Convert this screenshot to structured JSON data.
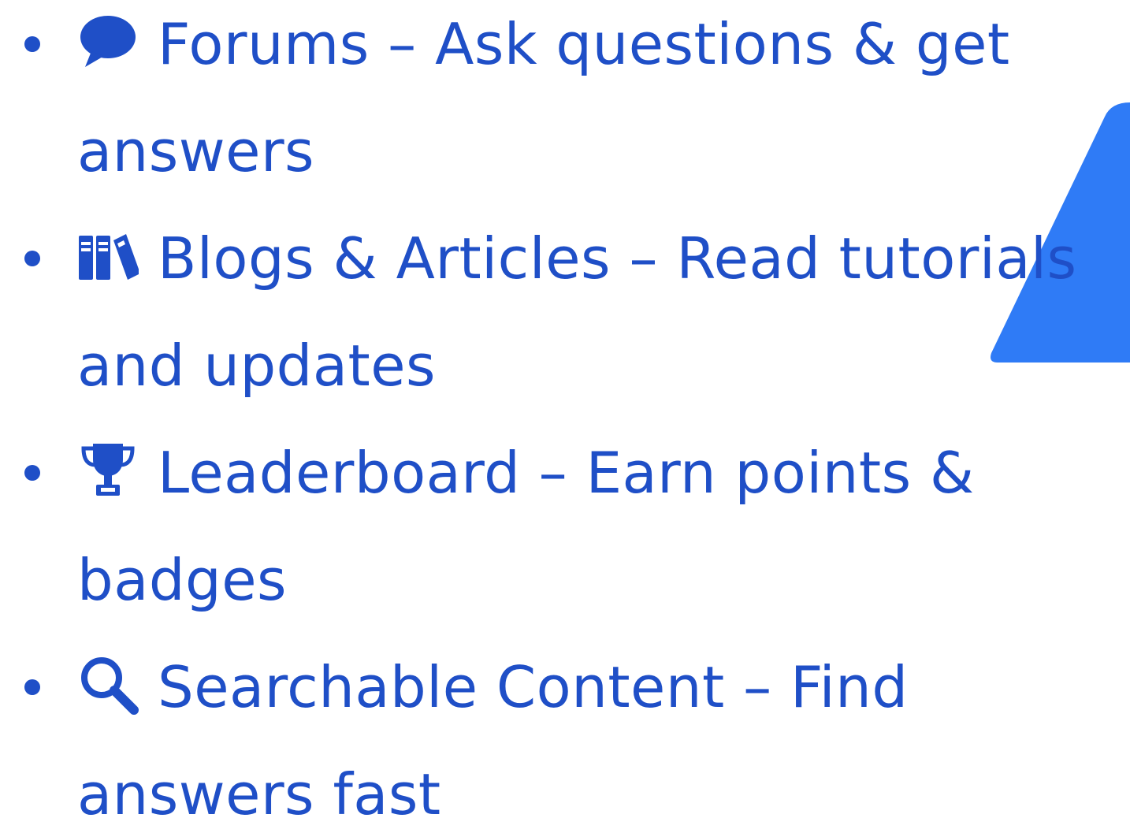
{
  "colors": {
    "text": "#1f4fc7",
    "accent": "#2f7bf6"
  },
  "features": [
    {
      "icon": "speech-bubble-icon",
      "title": "Forums",
      "separator": "–",
      "description": "Ask questions & get answers"
    },
    {
      "icon": "books-icon",
      "title": "Blogs & Articles",
      "separator": "–",
      "description": "Read tutorials and updates"
    },
    {
      "icon": "trophy-icon",
      "title": "Leaderboard",
      "separator": "–",
      "description": "Earn points & badges"
    },
    {
      "icon": "magnifier-icon",
      "title": "Searchable Content",
      "separator": "–",
      "description": "Find answers fast"
    }
  ]
}
